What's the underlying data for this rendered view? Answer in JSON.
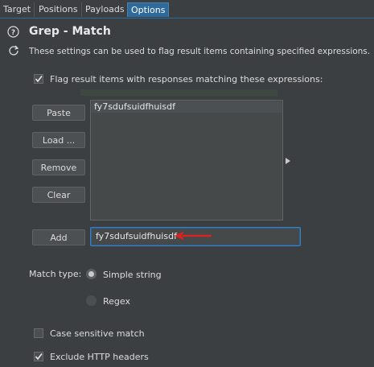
{
  "tabs": [
    {
      "label": "Target"
    },
    {
      "label": "Positions"
    },
    {
      "label": "Payloads"
    },
    {
      "label": "Options"
    }
  ],
  "section": {
    "title": "Grep - Match",
    "description": "These settings can be used to flag result items containing specified expressions."
  },
  "flag_checkbox": {
    "label": "Flag result items with responses matching these expressions:",
    "checked": true
  },
  "buttons": {
    "paste": "Paste",
    "load": "Load ...",
    "remove": "Remove",
    "clear": "Clear",
    "add": "Add"
  },
  "list": {
    "items": [
      "fy7sdufsuidfhuisdf"
    ]
  },
  "add_input": {
    "value": "fy7sdufsuidfhuisdf"
  },
  "match_type": {
    "label": "Match type:",
    "options": [
      {
        "label": "Simple string",
        "selected": true
      },
      {
        "label": "Regex",
        "selected": false
      }
    ]
  },
  "case_sensitive": {
    "label": "Case sensitive match",
    "checked": false
  },
  "exclude_headers": {
    "label": "Exclude HTTP headers",
    "checked": true
  },
  "colors": {
    "accent": "#2f6a9d",
    "background": "#3c3f41",
    "arrow": "#e0201c"
  },
  "icons": [
    "help-icon",
    "refresh-icon",
    "check-icon",
    "expand-arrow-icon",
    "red-arrow-annotation"
  ]
}
